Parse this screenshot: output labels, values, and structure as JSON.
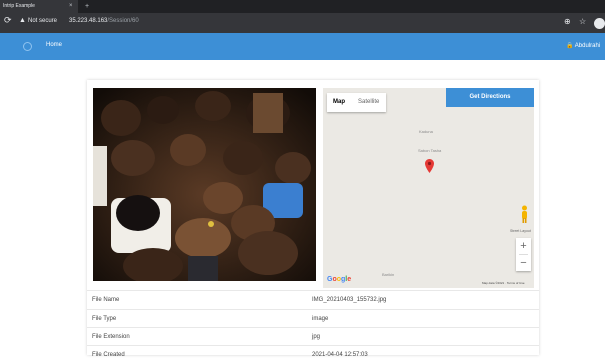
{
  "browser": {
    "tab_title": "Intrip Example",
    "tab_close": "×",
    "new_tab": "+",
    "reload_icon": "⟳",
    "warning_icon": "▲",
    "security_label": "Not secure",
    "url_host": "35.223.48.163",
    "url_path": "/Session/60",
    "search_icon": "⊕",
    "star_icon": "☆"
  },
  "navbar": {
    "home_label": "Home",
    "user_label": "🔒 Abdulrahi",
    "accent_color": "#3d8fd6"
  },
  "map": {
    "tab_map": "Map",
    "tab_satellite": "Satellite",
    "directions_label": "Get Directions",
    "place_1": "Kaduna",
    "place_2": "Sabon Tasha",
    "place_3": "Barikin",
    "street_view_label": "Street Layout",
    "zoom_in": "+",
    "zoom_out": "−",
    "logo_letters": [
      "G",
      "o",
      "o",
      "g",
      "l",
      "e"
    ],
    "logo_colors": [
      "#4285f4",
      "#ea4335",
      "#fbbc05",
      "#4285f4",
      "#34a853",
      "#ea4335"
    ],
    "footer": "Map data ©2021 · Terms of Use",
    "pin_color": "#e53935"
  },
  "file_info": [
    {
      "label": "File Name",
      "value": "IMG_20210403_155732.jpg"
    },
    {
      "label": "File Type",
      "value": "image"
    },
    {
      "label": "File Extension",
      "value": "jpg"
    },
    {
      "label": "File Created",
      "value": "2021-04-04 12:57:03"
    }
  ]
}
